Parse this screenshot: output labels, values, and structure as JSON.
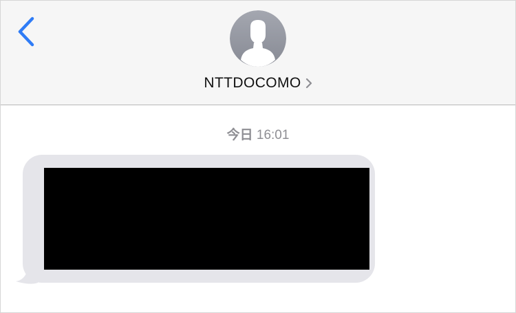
{
  "header": {
    "contact_name": "NTTDOCOMO",
    "back_icon": "chevron-left-icon",
    "avatar_icon": "person-silhouette-icon",
    "disclosure_icon": "chevron-right-icon"
  },
  "conversation": {
    "timestamp_day": "今日",
    "timestamp_time": "16:01",
    "message_content": "redacted"
  },
  "colors": {
    "accent": "#2f7cf6",
    "header_bg": "#f6f6f6",
    "bubble_bg": "#e5e5ea",
    "timestamp": "#8e8e93"
  }
}
